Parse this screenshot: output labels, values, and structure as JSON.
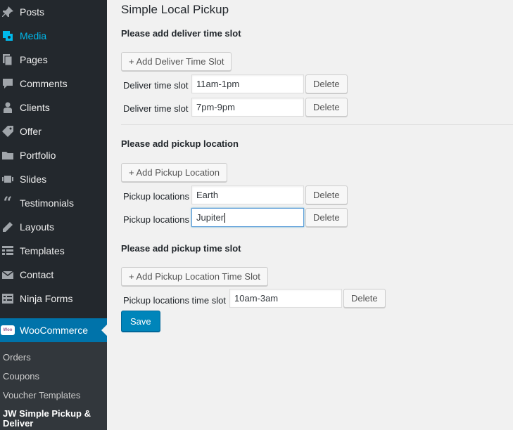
{
  "sidebar": {
    "items": [
      {
        "label": "Posts",
        "icon": "pin-icon"
      },
      {
        "label": "Media",
        "icon": "media-icon"
      },
      {
        "label": "Pages",
        "icon": "pages-icon"
      },
      {
        "label": "Comments",
        "icon": "comment-icon"
      },
      {
        "label": "Clients",
        "icon": "user-icon"
      },
      {
        "label": "Offer",
        "icon": "tag-icon"
      },
      {
        "label": "Portfolio",
        "icon": "folder-icon"
      },
      {
        "label": "Slides",
        "icon": "slides-icon"
      },
      {
        "label": "Testimonials",
        "icon": "quote-icon"
      },
      {
        "label": "Layouts",
        "icon": "pencil-icon"
      },
      {
        "label": "Templates",
        "icon": "grid-icon"
      },
      {
        "label": "Contact",
        "icon": "mail-icon"
      },
      {
        "label": "Ninja Forms",
        "icon": "form-icon"
      }
    ],
    "woocommerce": {
      "label": "WooCommerce",
      "logo_text": "Woo"
    },
    "submenu": [
      {
        "label": "Orders"
      },
      {
        "label": "Coupons"
      },
      {
        "label": "Voucher Templates"
      },
      {
        "label": "JW Simple Pickup & Deliver"
      }
    ],
    "accent_color": "#0073aa",
    "active_color": "#00b9eb"
  },
  "main": {
    "title": "Simple Local Pickup",
    "deliver": {
      "heading": "Please add deliver time slot",
      "add_label": "+ Add Deliver Time Slot",
      "rows": [
        {
          "label": "Deliver time slot",
          "value": "11am-1pm",
          "delete": "Delete"
        },
        {
          "label": "Deliver time slot",
          "value": "7pm-9pm",
          "delete": "Delete"
        }
      ]
    },
    "location": {
      "heading": "Please add pickup location",
      "add_label": "+ Add Pickup Location",
      "rows": [
        {
          "label": "Pickup locations",
          "value": "Earth",
          "delete": "Delete"
        },
        {
          "label": "Pickup locations",
          "value": "Jupiter",
          "delete": "Delete"
        }
      ]
    },
    "pickup_time": {
      "heading": "Please add pickup time slot",
      "add_label": "+ Add Pickup Location Time Slot",
      "rows": [
        {
          "label": "Pickup locations time slot",
          "value": "10am-3am",
          "delete": "Delete"
        }
      ]
    },
    "save_label": "Save",
    "save_color": "#0085ba"
  }
}
